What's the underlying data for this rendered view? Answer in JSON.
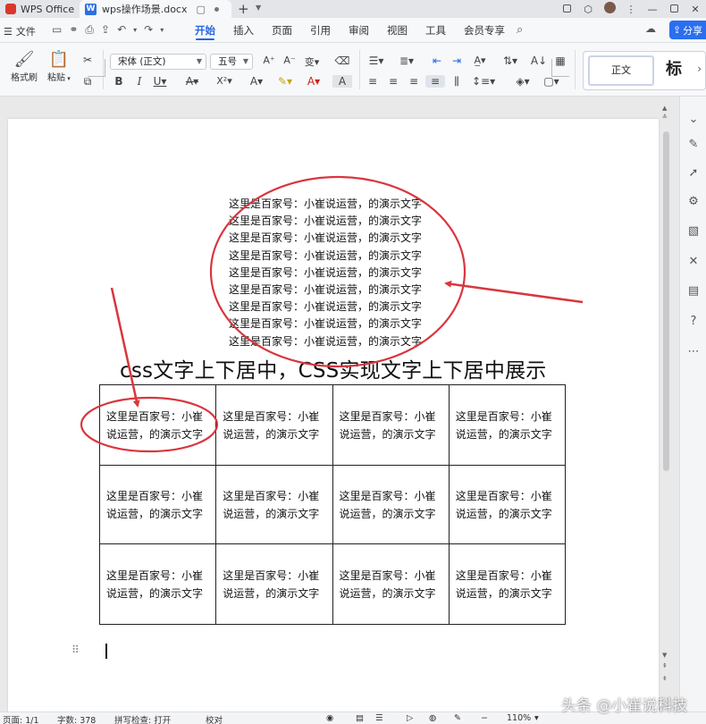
{
  "window": {
    "app_tab_label": "WPS Office",
    "doc_tab_label": "wps操作场景.docx",
    "doc_tab_icon": "W"
  },
  "menu": {
    "file_label": "文件",
    "items": [
      "开始",
      "插入",
      "页面",
      "引用",
      "审阅",
      "视图",
      "工具",
      "会员专享"
    ],
    "active_index": 0,
    "share_label": "分享"
  },
  "ribbon": {
    "format_painter_label": "格式刷",
    "paste_label": "粘贴",
    "font_name": "宋体 (正文)",
    "font_size": "五号",
    "style_normal": "正文",
    "style_heading": "标"
  },
  "document": {
    "lines": [
      "这里是百家号：小崔说运营，的演示文字",
      "这里是百家号：小崔说运营，的演示文字",
      "这里是百家号：小崔说运营，的演示文字",
      "这里是百家号：小崔说运营，的演示文字",
      "这里是百家号：小崔说运营，的演示文字",
      "这里是百家号：小崔说运营，的演示文字",
      "这里是百家号：小崔说运营，的演示文字",
      "这里是百家号：小崔说运营，的演示文字",
      "这里是百家号：小崔说运营，的演示文字"
    ],
    "table": [
      [
        "这里是百家号：小崔说运营，的演示文字",
        "这里是百家号：小崔说运营，的演示文字",
        "这里是百家号：小崔说运营，的演示文字",
        "这里是百家号：小崔说运营，的演示文字"
      ],
      [
        "这里是百家号：小崔说运营，的演示文字",
        "这里是百家号：小崔说运营，的演示文字",
        "这里是百家号：小崔说运营，的演示文字",
        "这里是百家号：小崔说运营，的演示文字"
      ],
      [
        "这里是百家号：小崔说运营，的演示文字",
        "这里是百家号：小崔说运营，的演示文字",
        "这里是百家号：小崔说运营，的演示文字",
        "这里是百家号：小崔说运营，的演示文字"
      ]
    ]
  },
  "overlay": {
    "caption": "css文字上下居中，CSS实现文字上下居中展示",
    "annotation_color": "#d9363e"
  },
  "statusbar": {
    "page": "页面: 1/1",
    "word_count": "字数: 378",
    "spell_check": "拼写检查: 打开",
    "proofread": "校对",
    "zoom": "110%"
  },
  "watermark": "头条 @小崔说科技",
  "colors": {
    "accent": "#2266e3",
    "share_button": "#2b6ef0",
    "annotation": "#d9363e"
  }
}
